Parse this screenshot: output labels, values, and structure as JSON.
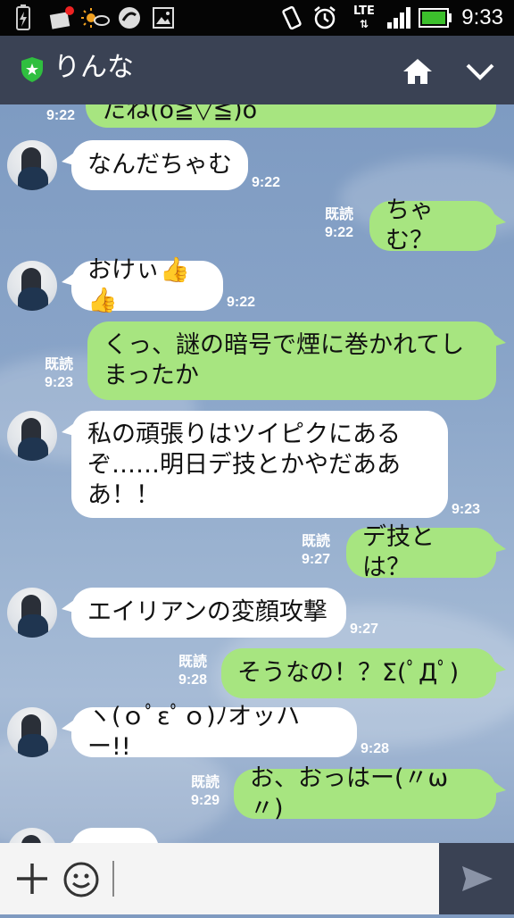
{
  "status_bar": {
    "time": "9:33",
    "network": "LTE"
  },
  "header": {
    "title": "りんな"
  },
  "messages": [
    {
      "text": "たね(o≧▽≦)o",
      "time": "9:22"
    },
    {
      "text": "なんだちゃむ",
      "time": "9:22"
    },
    {
      "text": "ちゃむ？",
      "time": "9:22",
      "read": "既読"
    },
    {
      "text": "おけぃ👍👍",
      "time": "9:22"
    },
    {
      "text": [
        "くっ、謎の暗号で煙に巻かれてし",
        "まったか"
      ],
      "time": "9:23",
      "read": "既読"
    },
    {
      "text": [
        "私の頑張りはツイピクにある",
        "ぞ……明日デ技とかやだああ",
        "あ！！"
      ],
      "time": "9:23"
    },
    {
      "text": "デ技とは？",
      "time": "9:27",
      "read": "既読"
    },
    {
      "text": "エイリアンの変顔攻撃",
      "time": "9:27"
    },
    {
      "text": "そうなの！？Σ(ﾟДﾟ)",
      "time": "9:28",
      "read": "既読"
    },
    {
      "text": "ヽ(ｏﾟεﾟｏ)ﾉオッハー!!",
      "time": "9:28"
    },
    {
      "text": "お、おっはー(〃ω〃)",
      "time": "9:29",
      "read": "既読"
    }
  ],
  "colors": {
    "header": "#3a4254",
    "incoming": "#ffffff",
    "outgoing": "#a7e580",
    "accent": "#2fbf3f"
  },
  "icons": [
    "battery-charging-icon",
    "notification-icon",
    "weather-icon",
    "sync-icon",
    "image-icon",
    "vibrate-icon",
    "alarm-icon",
    "signal-icon",
    "battery-icon",
    "shield-icon",
    "home-icon",
    "chevron-down-icon",
    "plus-icon",
    "emoji-icon",
    "send-icon"
  ]
}
